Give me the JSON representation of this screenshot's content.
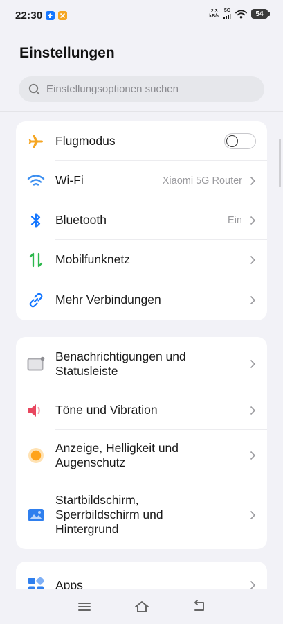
{
  "status_bar": {
    "time": "22:30",
    "net_speed_value": "2,3",
    "net_speed_unit": "kB/s",
    "network": "5G",
    "battery": "54",
    "badge_colors": [
      "#1677ff",
      "#f5a623"
    ]
  },
  "header": {
    "title": "Einstellungen"
  },
  "search": {
    "placeholder": "Einstellungsoptionen suchen"
  },
  "card1": {
    "items": [
      {
        "label": "Flugmodus",
        "icon": "airplane-icon",
        "toggle_on": false
      },
      {
        "label": "Wi-Fi",
        "value": "Xiaomi 5G Router",
        "icon": "wifi-icon"
      },
      {
        "label": "Bluetooth",
        "value": "Ein",
        "icon": "bluetooth-icon"
      },
      {
        "label": "Mobilfunknetz",
        "icon": "mobile-data-icon"
      },
      {
        "label": "Mehr Verbindungen",
        "icon": "link-icon"
      }
    ]
  },
  "card2": {
    "items": [
      {
        "label_line1": "Benachrichtigungen und",
        "label_line2": "Statusleiste",
        "icon": "notification-icon"
      },
      {
        "label": "Töne und Vibration",
        "icon": "speaker-icon"
      },
      {
        "label_line1": "Anzeige, Helligkeit und",
        "label_line2": "Augenschutz",
        "icon": "brightness-icon"
      },
      {
        "label_line1": "Startbildschirm,",
        "label_line2": "Sperrbildschirm und",
        "label_line3": "Hintergrund",
        "icon": "wallpaper-icon"
      }
    ]
  },
  "card3": {
    "items": [
      {
        "label": "Apps",
        "icon": "apps-icon"
      }
    ]
  },
  "colors": {
    "airplane": "#f5a623",
    "wifi": "#3b8ef0",
    "bluetooth": "#1677ff",
    "mobile_up": "#2db84d",
    "mobile_down": "#2db84d",
    "link": "#1677ff",
    "speaker": "#e8475f",
    "brightness": "#ffa31a",
    "wallpaper": "#2f7fee",
    "apps": "#2f7fee"
  }
}
